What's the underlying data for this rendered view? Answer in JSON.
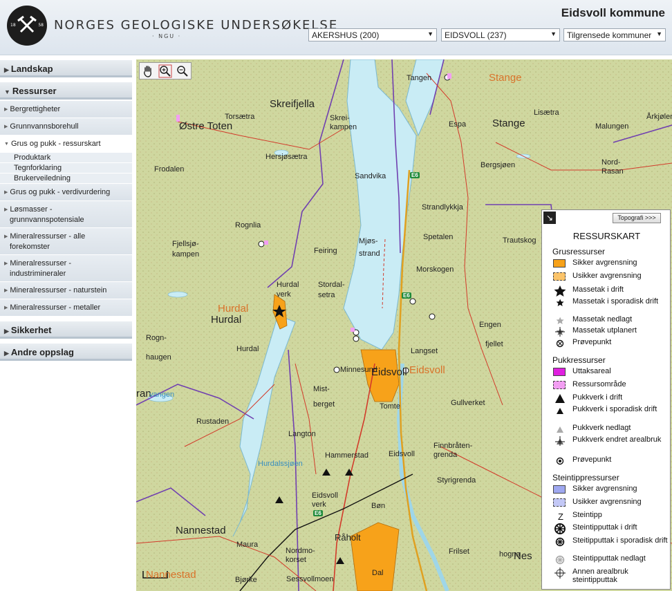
{
  "header": {
    "org_name": "NORGES GEOLOGISKE UNDERSØKELSE",
    "org_abbr": "· NGU ·",
    "logo_year_left": "18",
    "logo_year_right": "58",
    "kommune_title": "Eidsvoll kommune",
    "fylke_select": "AKERSHUS (200)",
    "kommune_select": "EIDSVOLL (237)",
    "nabo_select": "Tilgrensede kommuner"
  },
  "sidebar": {
    "landskap": "Landskap",
    "ressurser": "Ressurser",
    "items": [
      {
        "label": "Bergrettigheter"
      },
      {
        "label": "Grunnvannsborehull"
      },
      {
        "label": "Grus og pukk - ressurskart"
      },
      {
        "label": "Grus og pukk - verdivurdering"
      },
      {
        "label": "Løsmasser - grunnvannspotensiale",
        "l1": "Løsmasser -",
        "l2": "grunnvannspotensiale"
      },
      {
        "label": "Mineralressurser - alle forekomster",
        "l1": "Mineralressurser - alle",
        "l2": "forekomster"
      },
      {
        "label": "Mineralressurser - industrimineraler",
        "l1": "Mineralressurser -",
        "l2": "industrimineraler"
      },
      {
        "label": "Mineralressurser - naturstein"
      },
      {
        "label": "Mineralressurser - metaller"
      }
    ],
    "leaves": [
      "Produktark",
      "Tegnforklaring",
      "Brukerveiledning"
    ],
    "sikkerhet": "Sikkerhet",
    "andre": "Andre oppslag"
  },
  "map": {
    "labels": {
      "ostre_toten": "Østre Toten",
      "skreifjella": "Skreifjella",
      "tangen": "Tangen",
      "stange_o": "Stange",
      "stange": "Stange",
      "espa": "Espa",
      "lisaetra": "Lisætra",
      "malungen": "Malungen",
      "arkjolen": "Årkjølen",
      "torsaetra": "Torsætra",
      "skrei_kampen": "Skrei-\nkampen",
      "hersjosaetra": "Hersjøsætra",
      "frodalen": "Frodalen",
      "sandvika": "Sandvika",
      "bergsjoen": "Bergsjøen",
      "nord_rasan": "Nord-\nRasan",
      "strandlykkja": "Strandlykkja",
      "rognlia": "Rognlia",
      "spetalen": "Spetalen",
      "trautskog": "Trautskog",
      "morskogen": "Morskogen",
      "mjostrand": "Mjøs-\nstrand",
      "feiring": "Feiring",
      "fjellsjokampen": "Fjellsjø-\nkampen",
      "hurdal_verk": "Hurdal\nverk",
      "stordalsetra": "Stordal-\nsetra",
      "hurdal_o": "Hurdal",
      "hurdal": "Hurdal",
      "engen": "Engen",
      "fjellet": "fjellet",
      "rognhaugen": "Rogn-\nhaugen",
      "hurdal2": "Hurdal",
      "langset": "Langset",
      "minnesund": "Minnesund",
      "eidsvoll_o": "Eidsvoll",
      "eidsvoll_c": "Eidsvoll",
      "mistberget": "Mist-\nberget",
      "tomte": "Tomte",
      "gullverket": "Gullverket",
      "rustaden": "Rustaden",
      "langton": "Langton",
      "finnbraten": "Finnbråten-\ngrenda",
      "hammerstad": "Hammerstad",
      "eidsvoll2": "Eidsvoll",
      "hurdalssjoen": "Hurdalssjøen",
      "styrigrenda": "Styrigrenda",
      "eidsvoll_verk": "Eidsvoll\nverk",
      "bon": "Bøn",
      "nannestad": "Nannestad",
      "raholt": "Råholt",
      "maura": "Maura",
      "nordmokorset": "Nordmo-\nkorset",
      "frilset": "Frilset",
      "hogna": "hogna",
      "nes": "Nes",
      "bjorke": "Bjørke",
      "sessvollmoen": "Sessvollmoen",
      "dal": "Dal",
      "nannestad_o": "Nannestad",
      "tran": "ran",
      "vangen": "vangen"
    },
    "e6_label": "E6"
  },
  "legend": {
    "topo_button": "Topografi >>>",
    "title": "RESSURSKART",
    "grus_head": "Grusressurser",
    "pukk_head": "Pukkressurser",
    "stein_head": "Steintippressurser",
    "grus": [
      {
        "label": "Sikker avgrensning",
        "sym": "sq-orange"
      },
      {
        "label": "Usikker avgrensning",
        "sym": "sq-orange-light"
      },
      {
        "label": "Massetak i drift",
        "sym": "star-big"
      },
      {
        "label": "Massetak i sporadisk drift",
        "sym": "star-small"
      },
      {
        "label": "Massetak nedlagt",
        "sym": "star-grey"
      },
      {
        "label": "Massetak utplanert",
        "sym": "star-cross"
      },
      {
        "label": "Prøvepunkt",
        "sym": "circle-x"
      }
    ],
    "pukk": [
      {
        "label": "Uttaksareal",
        "sym": "sq-magenta"
      },
      {
        "label": "Ressursområde",
        "sym": "sq-pink"
      },
      {
        "label": "Pukkverk i drift",
        "sym": "tri-big"
      },
      {
        "label": "Pukkverk i sporadisk drift",
        "sym": "tri-small"
      },
      {
        "label": "Pukkverk nedlagt",
        "sym": "tri-grey"
      },
      {
        "label": "Pukkverk endret arealbruk",
        "sym": "tri-cross"
      },
      {
        "label": "Prøvepunkt",
        "sym": "circle-dot"
      }
    ],
    "stein": [
      {
        "label": "Sikker avgrensning",
        "sym": "sq-blue"
      },
      {
        "label": "Usikker avgrensning",
        "sym": "sq-blue-light"
      },
      {
        "label": "Steintipp",
        "sym": "z"
      },
      {
        "label": "Steintipputtak i drift",
        "sym": "wheel-big"
      },
      {
        "label": "Steitipputtak i sporadisk drift",
        "sym": "wheel-small"
      },
      {
        "label": "Steintipputtak nedlagt",
        "sym": "wheel-grey"
      },
      {
        "label": "Annen arealbruk steintipputtak",
        "sym": "wheel-cross"
      }
    ]
  },
  "colors": {
    "grus_sikker": "#f7a21a",
    "grus_usikker": "#fbc46a",
    "uttak": "#e020e0",
    "ressurs": "#f29ef2",
    "stein_sikker": "#9fa8f0",
    "stein_usikker": "#c3c8f6",
    "water": "#c9ecf5",
    "terrain": "#cfd79f",
    "border": "#7040b0"
  }
}
